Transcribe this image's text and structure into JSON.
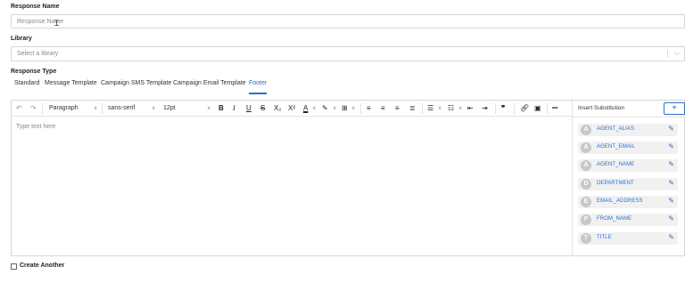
{
  "response_name": {
    "label": "Response Name",
    "placeholder": "Response Name"
  },
  "library": {
    "label": "Library",
    "placeholder": "Select a library"
  },
  "response_type": {
    "label": "Response Type",
    "tabs": [
      "Standard",
      "Message Template",
      "Campaign SMS Template",
      "Campaign Email Template",
      "Footer"
    ],
    "active_tab": "Footer"
  },
  "toolbar": {
    "block_format": "Paragraph",
    "font_family": "sans-serif",
    "font_size": "12pt",
    "bold": "B",
    "italic": "I",
    "underline": "U",
    "strike": "S",
    "subscript": "X₂",
    "superscript": "X²",
    "text_color": "A",
    "more": "•••"
  },
  "editor": {
    "placeholder": "Type text here"
  },
  "substitution": {
    "title": "Insert Substitution",
    "add_label": "+",
    "items": [
      {
        "initial": "A",
        "name": "AGENT_ALIAS"
      },
      {
        "initial": "A",
        "name": "AGENT_EMAIL"
      },
      {
        "initial": "A",
        "name": "AGENT_NAME"
      },
      {
        "initial": "D",
        "name": "DEPARTMENT"
      },
      {
        "initial": "E",
        "name": "EMAIL_ADDRESS"
      },
      {
        "initial": "F",
        "name": "FROM_NAME"
      },
      {
        "initial": "T",
        "name": "TITLE"
      }
    ]
  },
  "create_another": {
    "label": "Create Another",
    "checked": false
  },
  "colors": {
    "accent": "#2a6fce",
    "chip_bg": "#f1f1f1",
    "avatar": "#c8c8c8"
  }
}
